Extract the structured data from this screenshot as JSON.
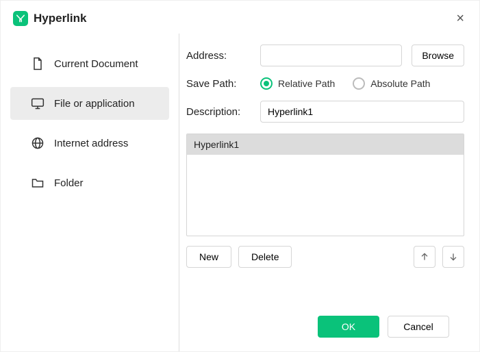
{
  "title": "Hyperlink",
  "close_symbol": "×",
  "sidebar": {
    "items": [
      {
        "label": "Current Document",
        "selected": false
      },
      {
        "label": "File or application",
        "selected": true
      },
      {
        "label": "Internet address",
        "selected": false
      },
      {
        "label": "Folder",
        "selected": false
      }
    ]
  },
  "form": {
    "address_label": "Address:",
    "address_value": "",
    "browse_label": "Browse",
    "savepath_label": "Save Path:",
    "radio_relative": "Relative Path",
    "radio_absolute": "Absolute Path",
    "radio_selected": "relative",
    "description_label": "Description:",
    "description_value": "Hyperlink1"
  },
  "list": {
    "items": [
      {
        "label": "Hyperlink1",
        "selected": true
      }
    ],
    "new_label": "New",
    "delete_label": "Delete"
  },
  "footer": {
    "ok_label": "OK",
    "cancel_label": "Cancel"
  }
}
